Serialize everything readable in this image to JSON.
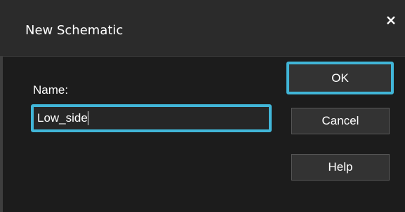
{
  "dialog": {
    "title": "New Schematic",
    "close_glyph": "×",
    "name_label": "Name:",
    "name_value": "Low_side",
    "buttons": {
      "ok": "OK",
      "cancel": "Cancel",
      "help": "Help"
    },
    "icons": {
      "close": "close-icon"
    },
    "colors": {
      "highlight": "#41b6d8",
      "background": "#2b2b2b",
      "body": "#1c1c1c"
    }
  }
}
